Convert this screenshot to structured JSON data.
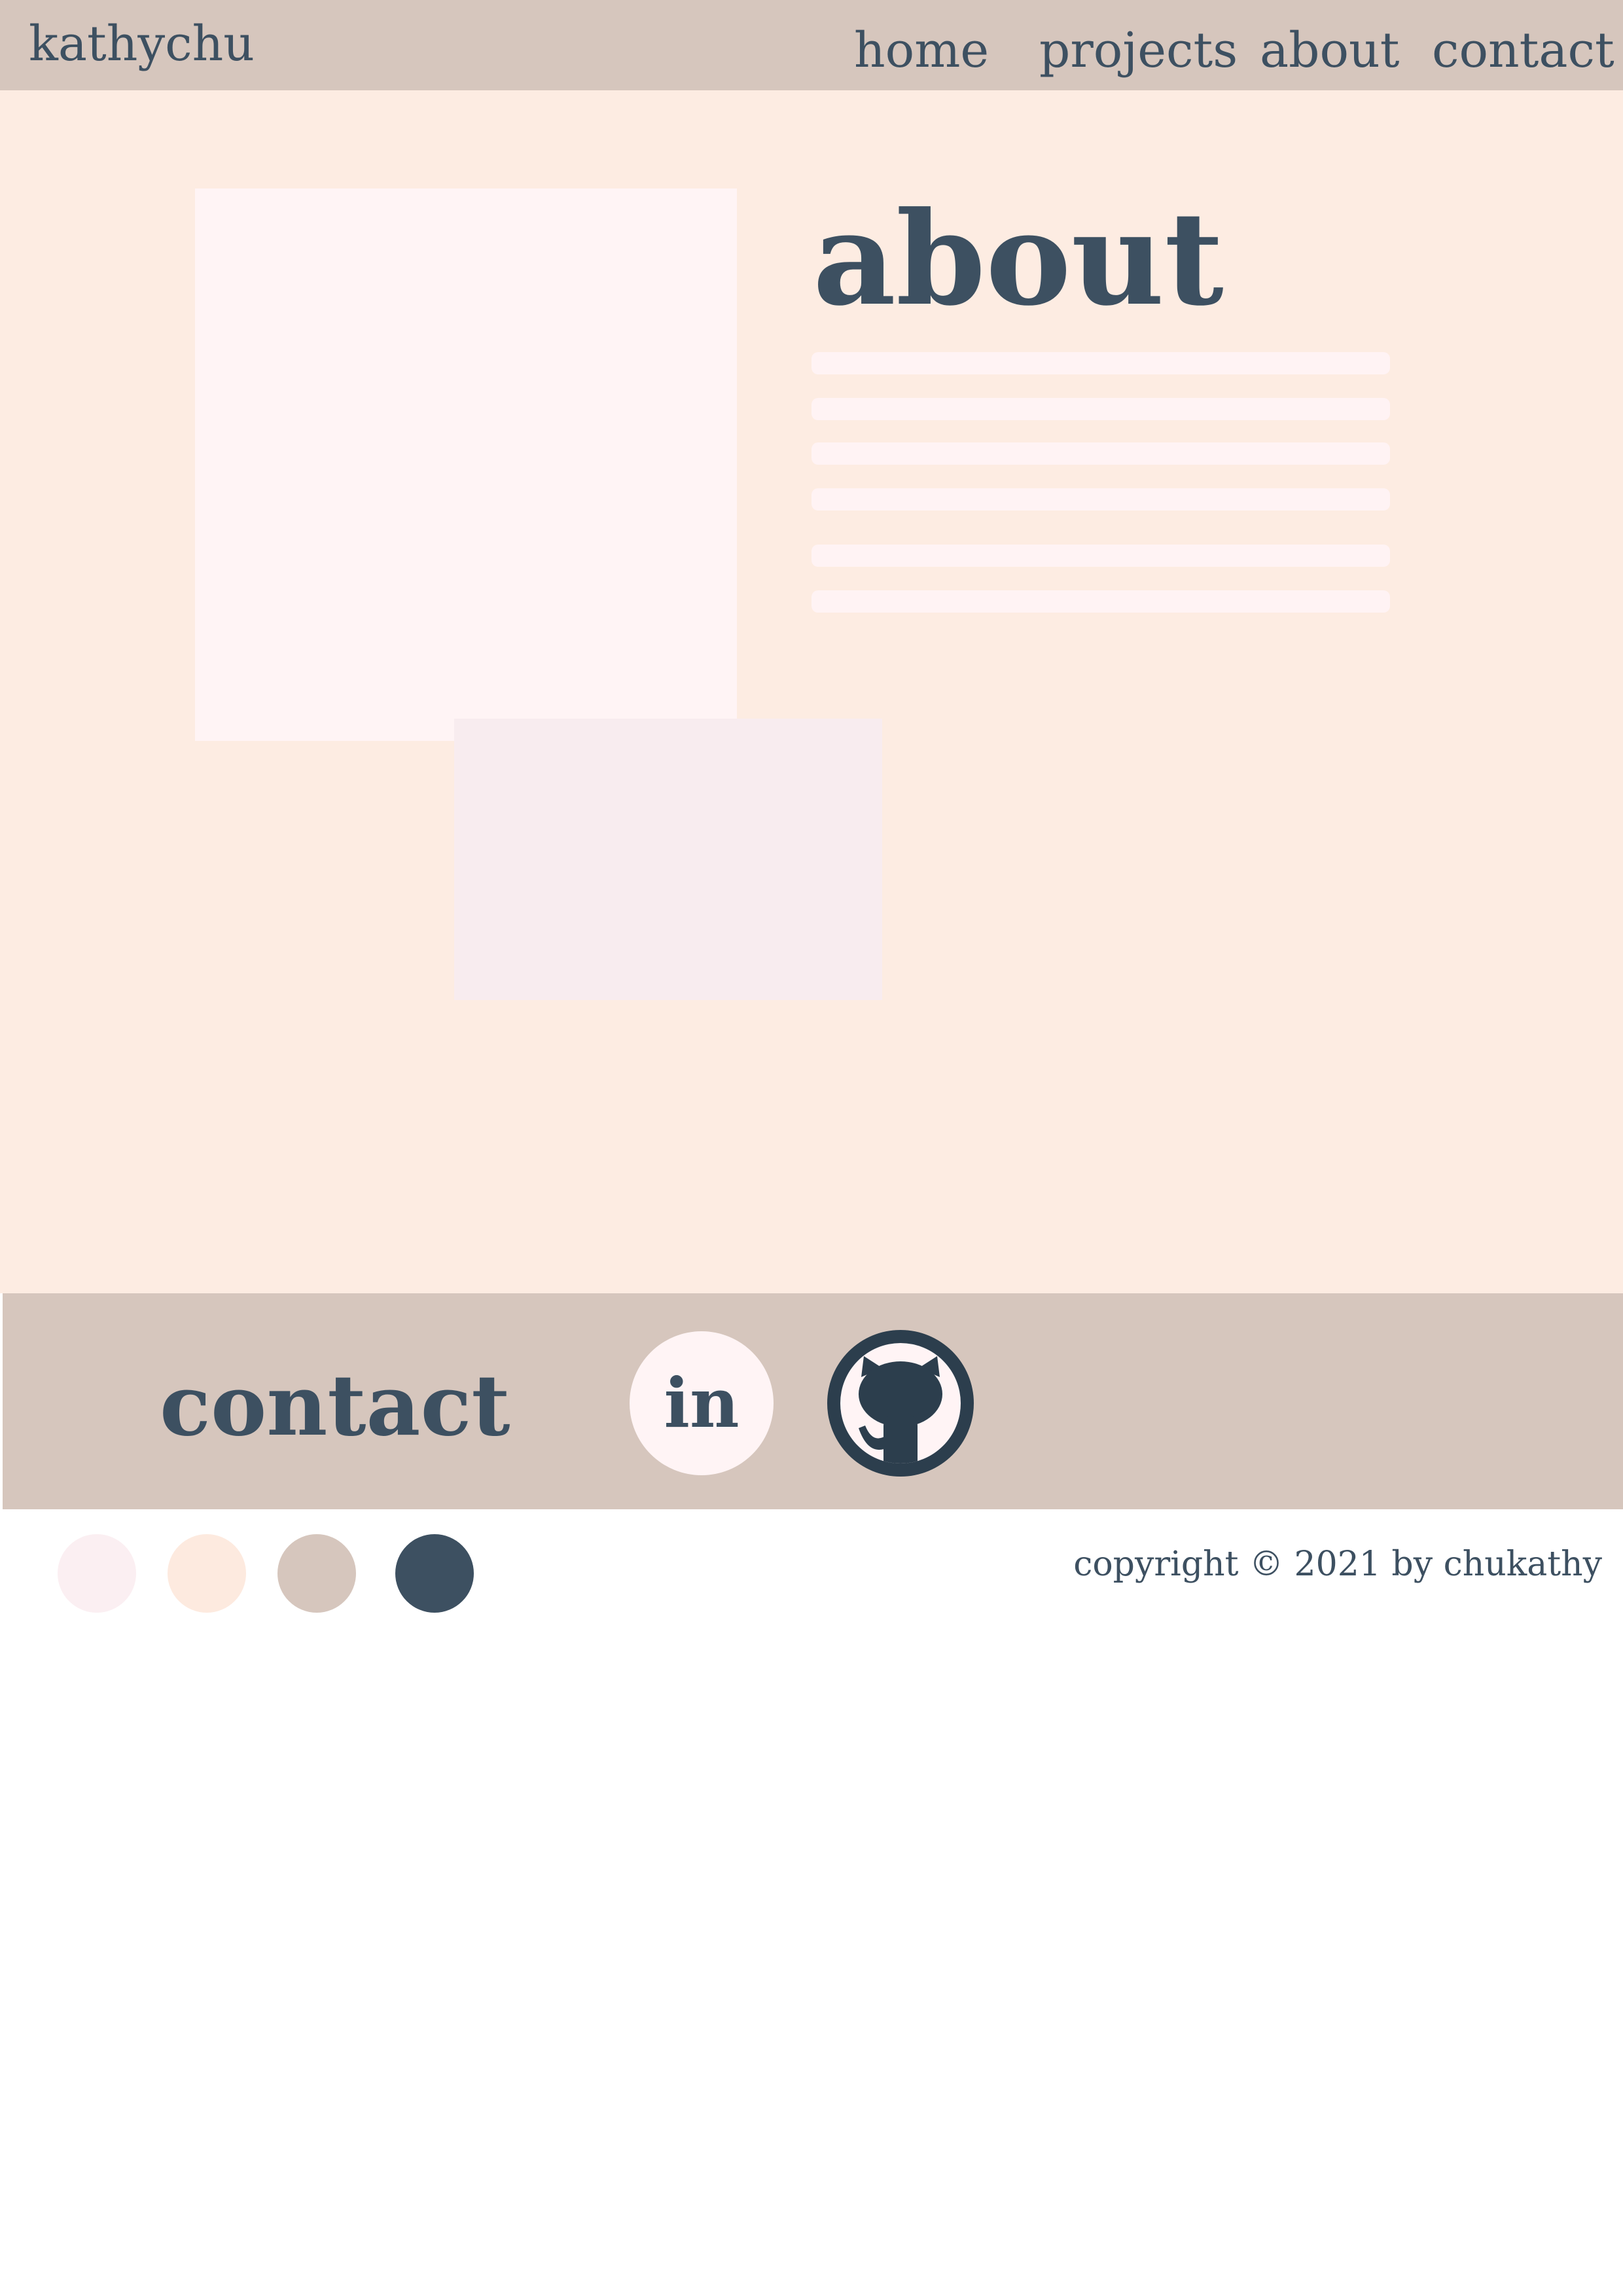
{
  "header": {
    "brand": "kathychu",
    "nav": [
      {
        "label": "home"
      },
      {
        "label": "projects"
      },
      {
        "label": "about"
      },
      {
        "label": "contact"
      }
    ]
  },
  "about_section": {
    "title": "about",
    "text_placeholder_lines": 6
  },
  "contact_section": {
    "title": "contact",
    "linkedin_label": "in",
    "github_icon": "github-octocat-icon"
  },
  "footer": {
    "palette": [
      "#fbeff2",
      "#fdeadf",
      "#d6c6bd",
      "#3d5061"
    ],
    "copyright": "copyright © 2021 by chukathy"
  },
  "colors": {
    "header_bg": "#d6c6bd",
    "main_bg": "#fdece2",
    "text": "#3d5061",
    "photo_main": "#fff4f5",
    "photo_secondary": "#f8ecef",
    "github_dark": "#2c3e4d"
  }
}
